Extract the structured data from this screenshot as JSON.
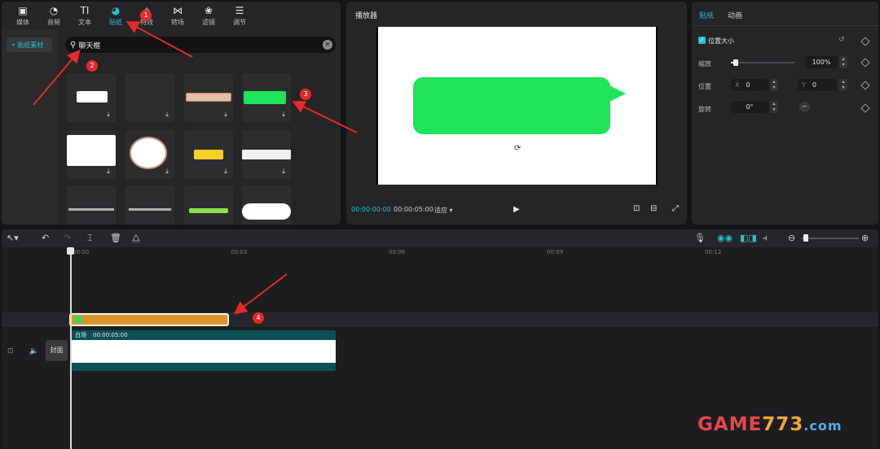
{
  "toolbar_tabs": [
    {
      "label": "媒体",
      "icon": "media-icon"
    },
    {
      "label": "音频",
      "icon": "audio-icon"
    },
    {
      "label": "文本",
      "icon": "text-icon"
    },
    {
      "label": "贴纸",
      "icon": "sticker-icon"
    },
    {
      "label": "特效",
      "icon": "effects-icon"
    },
    {
      "label": "转场",
      "icon": "transition-icon"
    },
    {
      "label": "滤镜",
      "icon": "filter-icon"
    },
    {
      "label": "调节",
      "icon": "adjust-icon"
    }
  ],
  "library": {
    "side_item": "• 贴纸素材",
    "search_value": "聊天框"
  },
  "player": {
    "title": "播放器",
    "current_time": "00:00:00:00",
    "total_time": "00:00:05:00",
    "ratio": "适应 ▾"
  },
  "properties": {
    "tabs": [
      "贴纸",
      "动画"
    ],
    "section": "位置大小",
    "scale_label": "缩放",
    "scale_value": "100%",
    "scale_fraction": 0.07,
    "position_label": "位置",
    "x_prefix": "X",
    "x_value": "0",
    "y_prefix": "Y",
    "y_value": "0",
    "rotation_label": "旋转",
    "rotation_value": "0°"
  },
  "timeline": {
    "ruler": [
      "00:00",
      "00:03",
      "00:06",
      "00:09",
      "00:12"
    ],
    "cover_label": "封面",
    "video_clip_name": "白场",
    "video_clip_duration": "00:00:05:00"
  },
  "annotations": [
    "1",
    "2",
    "3",
    "4"
  ],
  "watermark": {
    "part1": "GAME",
    "part2": "773",
    "part3": ".com"
  },
  "colors": {
    "accent": "#21c3d3",
    "sticker_green": "#1fe45a",
    "sticker_clip": "#d9962e",
    "video_clip": "#0c5055",
    "annotation_red": "#e52a2a"
  }
}
